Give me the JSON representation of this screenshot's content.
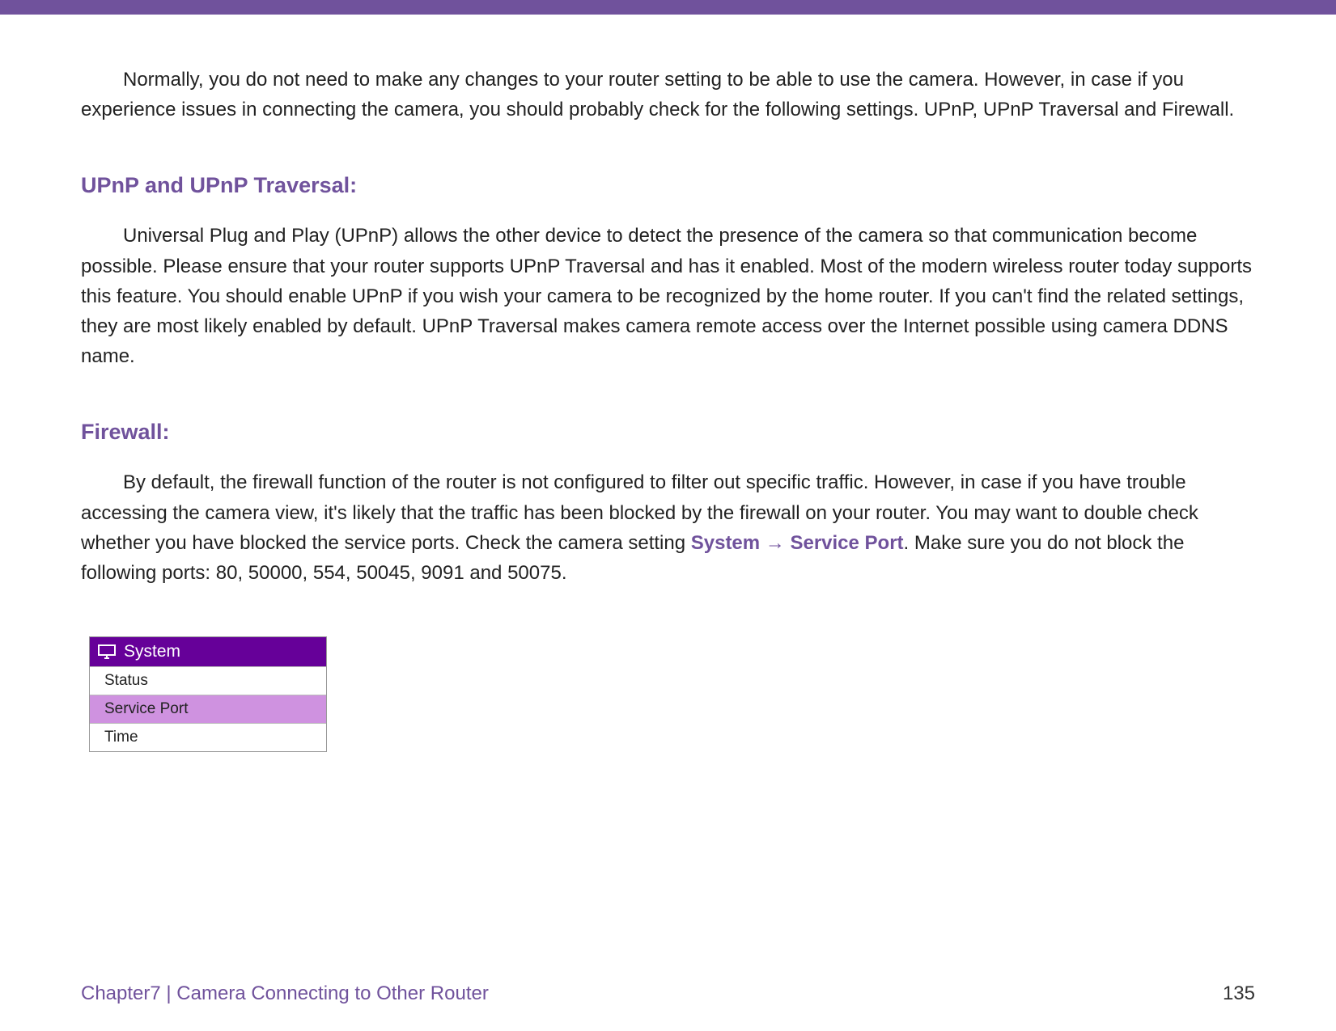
{
  "intro": "Normally, you do not need to make any changes to your router setting to be able to use the camera. However, in case if you experience issues in connecting the camera, you should probably check for the following settings. UPnP, UPnP Traversal and Firewall.",
  "section1": {
    "heading": "UPnP and UPnP Traversal:",
    "body": "Universal Plug and Play (UPnP) allows the other device to detect the presence of the camera so that communication become possible. Please ensure that your router supports UPnP Traversal and has it enabled. Most of the modern wireless router today supports this feature. You should enable UPnP if you wish your camera to be recognized by the home router. If you can't find the related settings, they are most likely enabled by default. UPnP Traversal makes camera remote access over the Internet possible using camera DDNS name."
  },
  "section2": {
    "heading": "Firewall:",
    "body_pre": "By default, the firewall function of the router is not configured to filter out specific traffic. However, in case if you have trouble accessing the camera view, it's likely that the traffic has been blocked by the firewall on your router. You may want to double check whether you have blocked the service ports. Check the camera setting ",
    "link1": "System",
    "arrow": " → ",
    "link2": "Service Port",
    "body_post": ". Make sure you do not block the following ports: 80, 50000, 554, 50045, 9091 and 50075."
  },
  "menu": {
    "header": "System",
    "items": [
      "Status",
      "Service Port",
      "Time"
    ],
    "selected_index": 1
  },
  "footer": {
    "left": "Chapter7  |  Camera Connecting to Other Router",
    "page_number": "135"
  }
}
